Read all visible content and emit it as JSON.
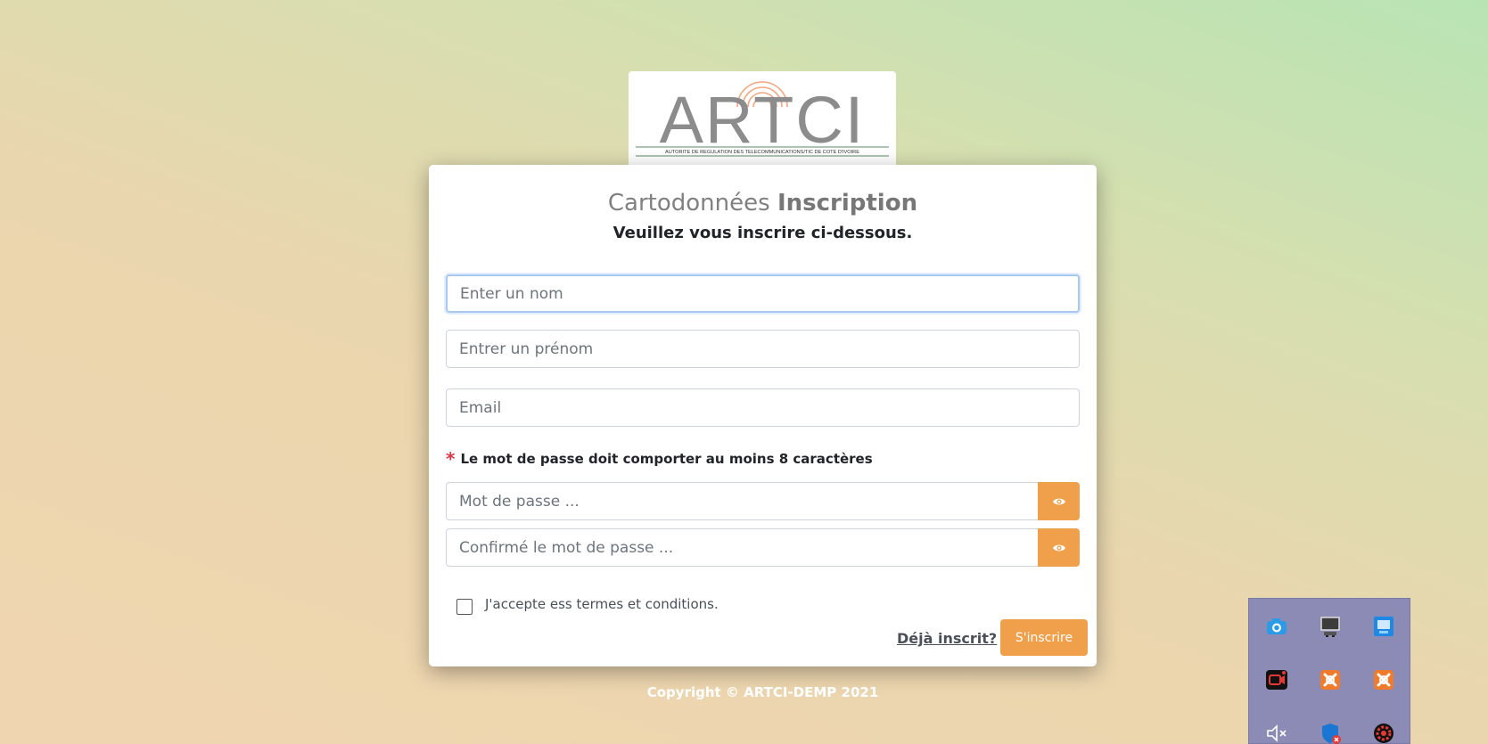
{
  "logo": {
    "name": "ARTCI",
    "tagline": "AUTORITE DE REGULATION DES TELECOMMUNICATIONS/TIC DE COTE D'IVOIRE"
  },
  "form": {
    "title_light": "Cartodonnées",
    "title_bold": "Inscription",
    "subtitle": "Veuillez vous inscrire ci-dessous.",
    "nom_placeholder": "Enter un nom",
    "prenom_placeholder": "Entrer un prénom",
    "email_placeholder": "Email",
    "password_rule_marker": "*",
    "password_rule": "Le mot de passe doit comporter au moins 8 caractères",
    "password_placeholder": "Mot de passe ...",
    "confirm_placeholder": "Confirmé le mot de passe ...",
    "terms_label": "J'accepte ess termes et conditions.",
    "already_registered": "Déjà inscrit?",
    "submit_label": "S'inscrire"
  },
  "footer": {
    "copyright": "Copyright © ARTCI-DEMP 2021"
  },
  "colors": {
    "accent": "#f0a04b",
    "focus_border": "#a9c8f0",
    "required": "#dc3545"
  },
  "tray": {
    "icons": [
      "camera-search-icon",
      "display-icon",
      "network-adapter-icon",
      "screen-recorder-icon",
      "xampp-icon",
      "xampp-icon",
      "volume-muted-icon",
      "defender-icon",
      "app-settings-icon"
    ]
  }
}
